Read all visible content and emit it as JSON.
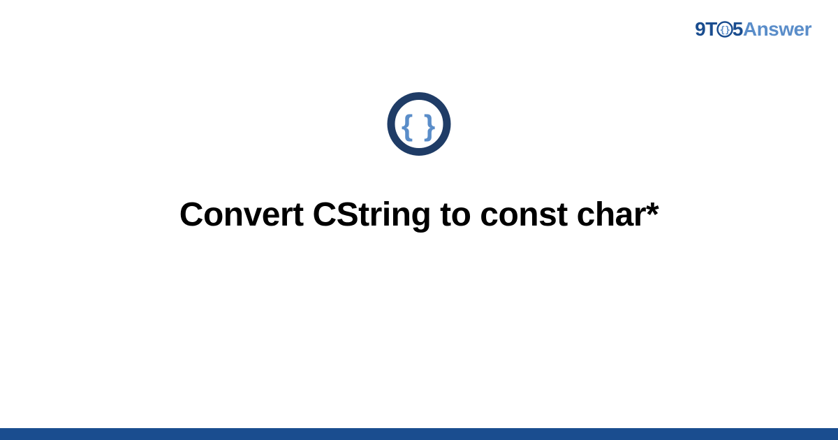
{
  "logo": {
    "nine": "9",
    "t": "T",
    "five": "5",
    "answer": "Answer"
  },
  "title": "Convert CString to const char*",
  "icon": {
    "name": "braces-icon",
    "label": "code braces"
  },
  "colors": {
    "primary": "#1a4d8f",
    "secondary": "#5a8dc9",
    "accent_ring": "#1f3c66",
    "braces": "#5a8dc9"
  }
}
